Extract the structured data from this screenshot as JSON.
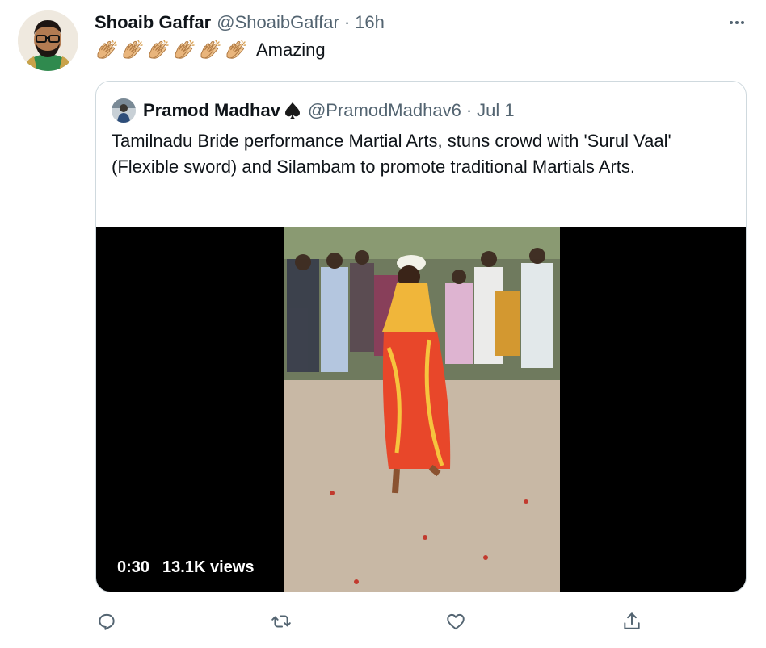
{
  "author": {
    "display_name": "Shoaib Gaffar",
    "handle": "@ShoaibGaffar",
    "separator": "·",
    "time": "16h"
  },
  "tweet": {
    "clap_emoji_count": 6,
    "text": "Amazing"
  },
  "quoted": {
    "display_name": "Pramod Madhav",
    "handle": "@PramodMadhav6",
    "separator": "·",
    "date": "Jul 1",
    "text": "Tamilnadu Bride performance Martial Arts, stuns crowd with 'Surul Vaal' (Flexible sword) and Silambam to promote traditional Martials Arts.",
    "video": {
      "duration": "0:30",
      "views": "13.1K views"
    }
  },
  "actions": [
    "reply-icon",
    "retweet-icon",
    "like-icon",
    "share-icon"
  ],
  "colors": {
    "text_primary": "#0f1419",
    "text_secondary": "#536471",
    "border": "#cfd9de"
  }
}
